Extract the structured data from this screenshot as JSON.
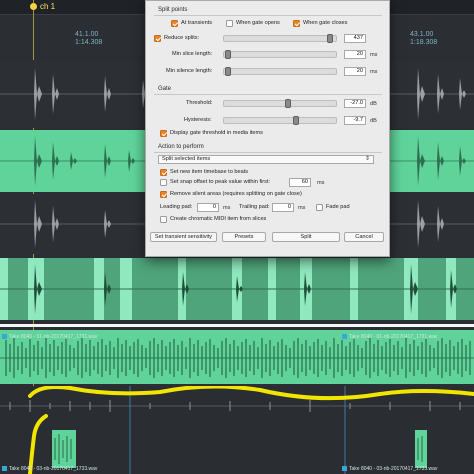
{
  "marker": {
    "label": "ch 1"
  },
  "timeline": {
    "pos_left_1": "41.1.00",
    "pos_left_2": "1:14.308",
    "pos_right_1": "43.1.00",
    "pos_right_2": "1:18.308"
  },
  "takes": {
    "label_1_left": "Take 8040 - 01-nb-20170417_1731.wav",
    "label_1_right": "Take 8040 - 01-nb-20170417_1731.wav",
    "label_2_left": "Take 8040 - 03-nb-20170417_1733.wav",
    "label_2_right": "Take 8040 - 03-nb-20170417_1733.wav"
  },
  "dialog": {
    "split_points": {
      "title": "Split points",
      "at_transients": {
        "label": "At transients",
        "checked": true
      },
      "when_gate_opens": {
        "label": "When gate opens",
        "checked": false
      },
      "when_gate_closes": {
        "label": "When gate closes",
        "checked": true
      },
      "reduce_splits": {
        "label": "Reduce splits:",
        "checked": true,
        "value": "437",
        "slider_fraction": 0.92
      },
      "min_slice_length": {
        "label": "Min slice length:",
        "value": "20",
        "unit": "ms",
        "slider_fraction": 0.02
      },
      "min_silence_length": {
        "label": "Min silence length:",
        "value": "20",
        "unit": "ms",
        "slider_fraction": 0.02
      }
    },
    "gate": {
      "title": "Gate",
      "threshold": {
        "label": "Threshold:",
        "value": "-27.0",
        "unit": "dB",
        "slider_fraction": 0.55
      },
      "hysteresis": {
        "label": "Hysteresis:",
        "value": "-9.7",
        "unit": "dB",
        "slider_fraction": 0.62
      },
      "display_threshold": {
        "label": "Display gate threshold in media items",
        "checked": true
      }
    },
    "action": {
      "title": "Action to perform",
      "selected": "Split selected items",
      "set_new_item_timebase": {
        "label": "Set new item timebase to beats",
        "checked": true
      },
      "set_snap_offset": {
        "label": "Set snap offset to peak value within first:",
        "checked": false,
        "value": "60",
        "unit": "ms"
      },
      "remove_silent": {
        "label": "Remove silent areas (requires splitting on gate close)",
        "checked": true
      },
      "leading_pad": {
        "label": "Leading pad:",
        "value": "0",
        "unit": "ms"
      },
      "trailing_pad": {
        "label": "Trailing pad:",
        "value": "0",
        "unit": "ms"
      },
      "fade_pad": {
        "label": "Fade pad",
        "checked": false
      },
      "create_midi": {
        "label": "Create chromatic MIDI item from slices",
        "checked": false
      }
    },
    "buttons": {
      "set_sensitivity": "Set transient sensitivity",
      "presets": "Presets",
      "split": "Split",
      "cancel": "Cancel"
    }
  },
  "colors": {
    "accent": "#e8842a",
    "item_green": "#5fd39a",
    "waveform_gray": "#9aa0a6",
    "annotation": "#f2e600"
  }
}
